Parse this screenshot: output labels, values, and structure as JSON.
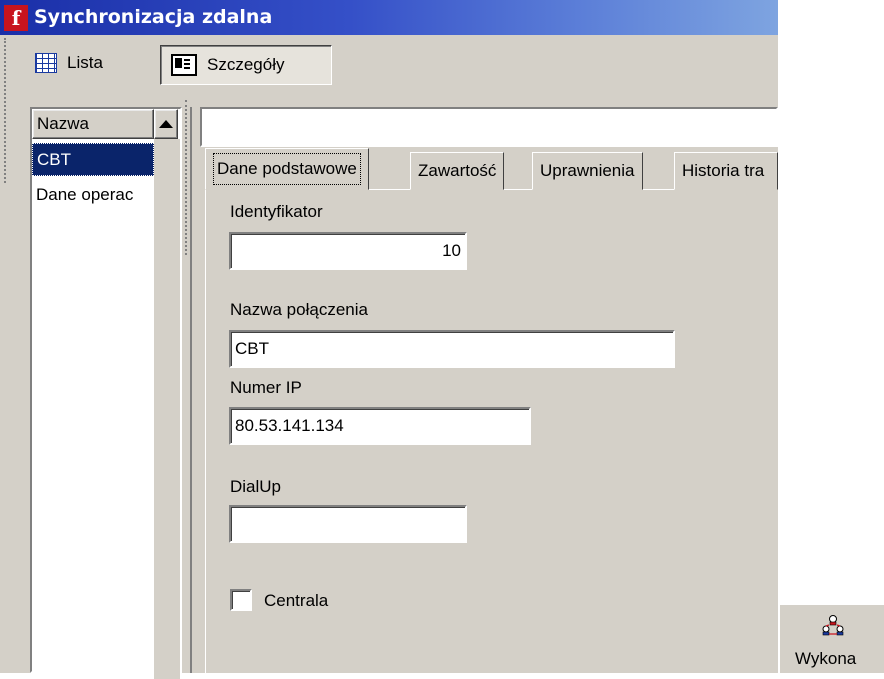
{
  "window": {
    "title": "Synchronizacja zdalna",
    "app_icon_glyph": "f"
  },
  "toolbar": {
    "lista_label": "Lista",
    "szczegoly_label": "Szczegóły"
  },
  "list": {
    "header": "Nazwa",
    "rows": [
      "CBT",
      "Dane operac"
    ],
    "selected_index": 0
  },
  "tabs": [
    "Dane podstawowe",
    "Zawartość",
    "Uprawnienia",
    "Historia tra"
  ],
  "form": {
    "identyfikator_label": "Identyfikator",
    "identyfikator_value": "10",
    "nazwa_label": "Nazwa połączenia",
    "nazwa_value": "CBT",
    "ip_label": "Numer IP",
    "ip_value": "80.53.141.134",
    "dialup_label": "DialUp",
    "dialup_value": "",
    "centrala_label": "Centrala",
    "centrala_checked": false
  },
  "actions": {
    "wykonaj_label": "Wykona"
  },
  "icons": {
    "app": "app-logo-icon",
    "lista": "list-view-icon",
    "szczegoly": "details-view-icon",
    "wykonaj": "network-sync-icon"
  },
  "colors": {
    "titlebar_start": "#1a2fa8",
    "titlebar_end": "#7ea4e0",
    "face": "#d4d0c8",
    "selection": "#0a246a",
    "app_icon": "#c8141e"
  }
}
